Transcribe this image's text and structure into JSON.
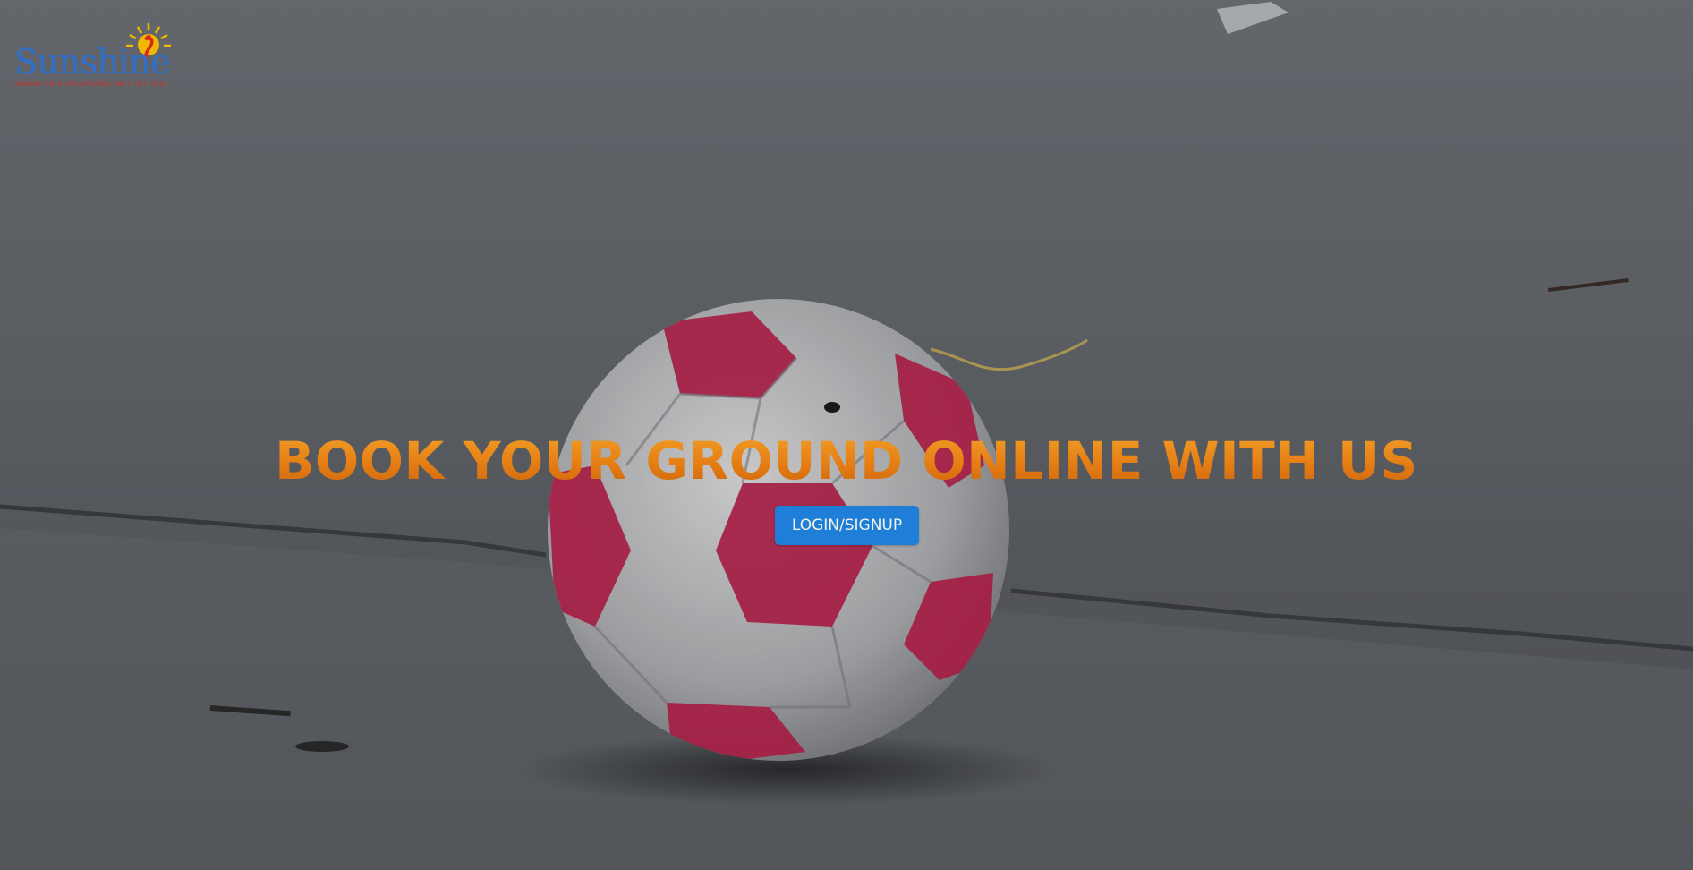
{
  "brand": {
    "name": "Sunshine",
    "tagline": "GROUP OF EDUCATIONAL INSTITUTIONS",
    "icon": "sun-figure-logo-icon",
    "colors": {
      "wordmark": "#2f6fd0",
      "tagline": "#d22a1c",
      "sun": "#f2b705"
    }
  },
  "hero": {
    "heading": "BOOK YOUR GROUND ONLINE WITH US",
    "cta_label": "LOGIN/SIGNUP",
    "colors": {
      "heading": "#e8891c",
      "cta_background": "#1f7fd8",
      "cta_text": "#f2f2ea"
    },
    "background_subject": "football-on-concrete-photo"
  }
}
